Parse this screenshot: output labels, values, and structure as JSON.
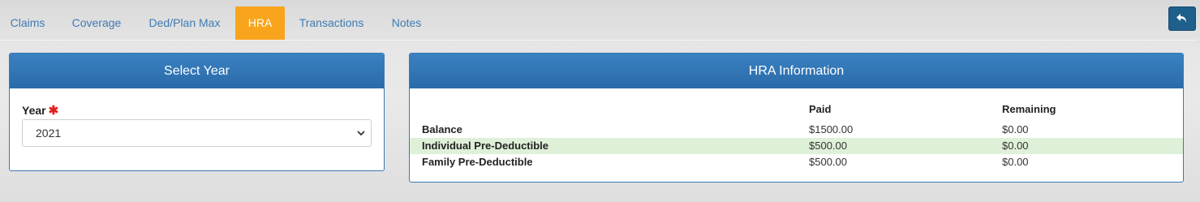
{
  "tabs": [
    {
      "label": "Claims"
    },
    {
      "label": "Coverage"
    },
    {
      "label": "Ded/Plan Max"
    },
    {
      "label": "HRA"
    },
    {
      "label": "Transactions"
    },
    {
      "label": "Notes"
    }
  ],
  "active_tab": "HRA",
  "back_button_icon": "undo-arrow-icon",
  "select_year_panel": {
    "title": "Select Year",
    "year_label": "Year",
    "required_marker": "✱",
    "selected_year": "2021"
  },
  "hra_panel": {
    "title": "HRA Information",
    "columns": [
      "",
      "Paid",
      "Remaining"
    ],
    "rows": [
      {
        "label": "Balance",
        "paid": "$1500.00",
        "remaining": "$0.00"
      },
      {
        "label": "Individual Pre-Deductible",
        "paid": "$500.00",
        "remaining": "$0.00"
      },
      {
        "label": "Family Pre-Deductible",
        "paid": "$500.00",
        "remaining": "$0.00"
      }
    ]
  },
  "colors": {
    "tab_text": "#3f7bb3",
    "active_tab_bg": "#f8a51d",
    "panel_header": "#2f74b5",
    "back_button": "#1f5f8c",
    "highlight_row": "#dff0d8",
    "required": "#e02020"
  }
}
